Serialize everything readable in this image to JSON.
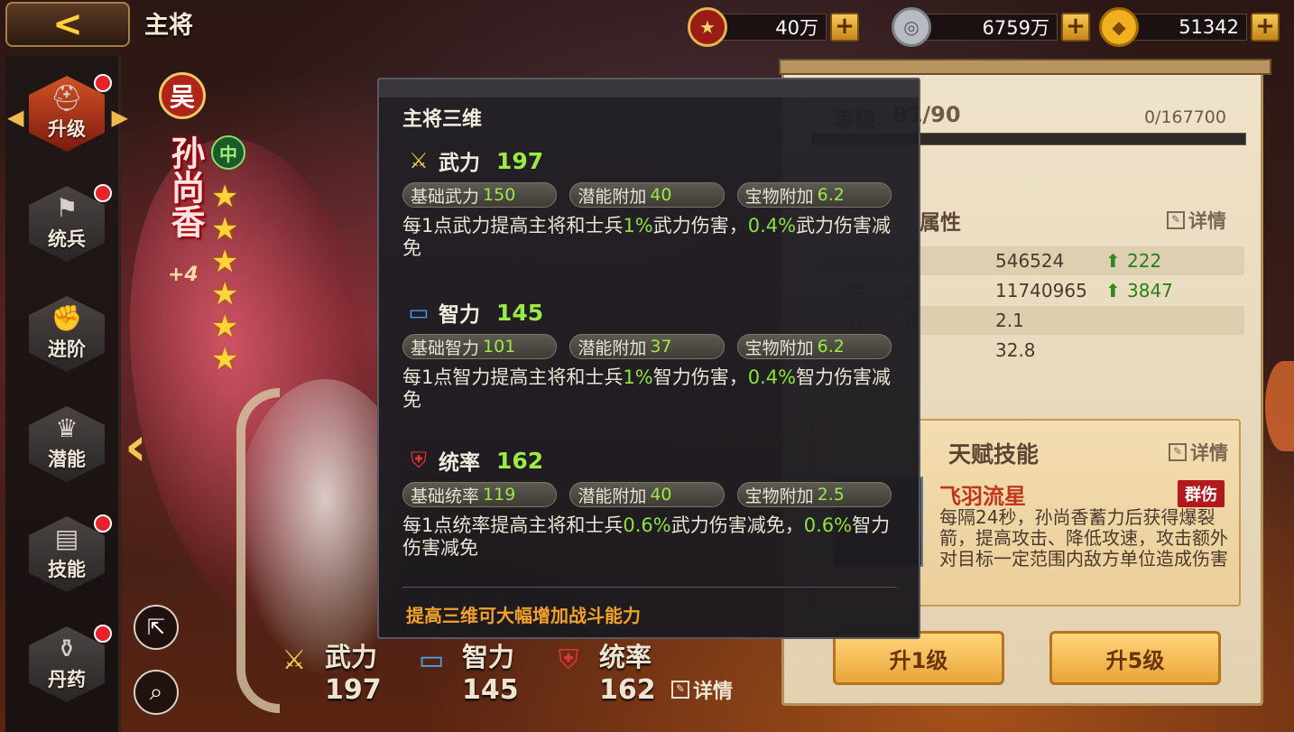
{
  "header": {
    "title": "主将"
  },
  "currencies": [
    {
      "icon": "rank-medal-icon",
      "value": "40万"
    },
    {
      "icon": "silver-coin-icon",
      "value": "6759万"
    },
    {
      "icon": "gold-ingot-icon",
      "value": "51342"
    }
  ],
  "currency_plus": "+",
  "sidebar": {
    "items": [
      {
        "label": "升级",
        "icon": "helmet-icon",
        "active": true,
        "dot": true
      },
      {
        "label": "统兵",
        "icon": "flag-icon",
        "active": false,
        "dot": true
      },
      {
        "label": "进阶",
        "icon": "fist-up-icon",
        "active": false,
        "dot": false
      },
      {
        "label": "潜能",
        "icon": "crown-icon",
        "active": false,
        "dot": false
      },
      {
        "label": "技能",
        "icon": "book-icon",
        "active": false,
        "dot": true
      },
      {
        "label": "丹药",
        "icon": "elixir-icon",
        "active": false,
        "dot": true
      }
    ]
  },
  "hero": {
    "faction": "吴",
    "name": "孙尚香",
    "plus": "+4",
    "role_badge": "中",
    "stars": 6
  },
  "bottom_stats": [
    {
      "name": "武力",
      "value": "197",
      "icon": "crossed-swords-icon"
    },
    {
      "name": "智力",
      "value": "145",
      "icon": "scroll-icon"
    },
    {
      "name": "统率",
      "value": "162",
      "icon": "command-shield-icon"
    }
  ],
  "bottom_detail": "详情",
  "right_panel": {
    "level_label": "等级",
    "level_value": "81/90",
    "exp_text": "0/167700",
    "attr_title": "属性",
    "attr_detail": "详情",
    "attributes": [
      {
        "k1": "攻",
        "k2": "击",
        "value": "546524",
        "up": "222"
      },
      {
        "k1": "生",
        "k2": "命",
        "value": "11740965",
        "up": "3847"
      },
      {
        "k1": "攻",
        "k2": "速",
        "value": "2.1",
        "up": ""
      },
      {
        "k1": "",
        "k2": "",
        "value": "32.8",
        "up": ""
      }
    ],
    "talent_title": "天赋技能",
    "talent_detail": "详情",
    "skill_name": "飞羽流星",
    "skill_tag": "群伤",
    "skill_desc": "每隔24秒，孙尚香蓄力后获得爆裂箭，提高攻击、降低攻速，攻击额外对目标一定范围内敌方单位造成伤害",
    "btn_up1": "升1级",
    "btn_up5": "升5级"
  },
  "popup": {
    "title": "主将三维",
    "stats": [
      {
        "name": "武力",
        "value": "197",
        "icon": "crossed-swords-icon",
        "pills": [
          {
            "label": "基础武力",
            "value": "150"
          },
          {
            "label": "潜能附加",
            "value": "40"
          },
          {
            "label": "宝物附加",
            "value": "6.2"
          }
        ],
        "desc_a": "每1点武力提高主将和士兵",
        "desc_g1": "1%",
        "desc_b": "武力伤害，",
        "desc_g2": "0.4%",
        "desc_c": "武力伤害减免"
      },
      {
        "name": "智力",
        "value": "145",
        "icon": "scroll-icon",
        "pills": [
          {
            "label": "基础智力",
            "value": "101"
          },
          {
            "label": "潜能附加",
            "value": "37"
          },
          {
            "label": "宝物附加",
            "value": "6.2"
          }
        ],
        "desc_a": "每1点智力提高主将和士兵",
        "desc_g1": "1%",
        "desc_b": "智力伤害，",
        "desc_g2": "0.4%",
        "desc_c": "智力伤害减免"
      },
      {
        "name": "统率",
        "value": "162",
        "icon": "command-shield-icon",
        "pills": [
          {
            "label": "基础统率",
            "value": "119"
          },
          {
            "label": "潜能附加",
            "value": "40"
          },
          {
            "label": "宝物附加",
            "value": "2.5"
          }
        ],
        "desc_a": "每1点统率提高主将和士兵",
        "desc_g1": "0.6%",
        "desc_b": "武力伤害减免，",
        "desc_g2": "0.6%",
        "desc_c": "智力伤害减免"
      }
    ],
    "tip": "提高三维可大幅增加战斗能力"
  }
}
